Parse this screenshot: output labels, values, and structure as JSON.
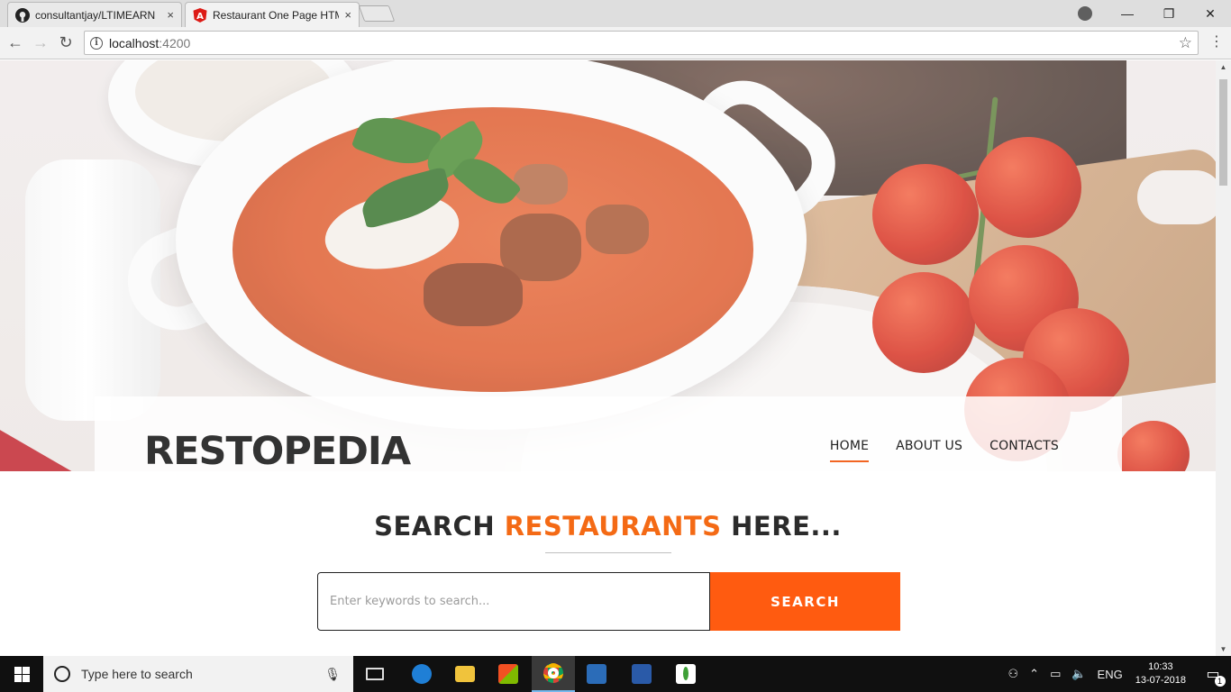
{
  "browser": {
    "tabs": [
      {
        "title": "consultantjay/LTIMEARN",
        "favicon": "github-icon",
        "close": "×"
      },
      {
        "title": "Restaurant One Page HTML",
        "favicon": "angular-icon",
        "close": "×"
      }
    ],
    "address": {
      "host": "localhost",
      "port": ":4200"
    },
    "window_controls": {
      "minimize": "—",
      "maximize": "❐",
      "close": "✕"
    }
  },
  "page": {
    "brand": "RESTOPEDIA",
    "nav": [
      {
        "label": "HOME",
        "active": true
      },
      {
        "label": "ABOUT US",
        "active": false
      },
      {
        "label": "CONTACTS",
        "active": false
      }
    ],
    "search": {
      "title_prefix": "SEARCH ",
      "title_accent": "RESTAURANTS",
      "title_suffix": " HERE...",
      "placeholder": "Enter keywords to search...",
      "button_label": "SEARCH"
    },
    "colors": {
      "accent": "#f46a15",
      "button": "#ff5b10"
    }
  },
  "taskbar": {
    "search_placeholder": "Type here to search",
    "language": "ENG",
    "time": "10:33",
    "date": "13-07-2018",
    "notification_count": "1"
  }
}
